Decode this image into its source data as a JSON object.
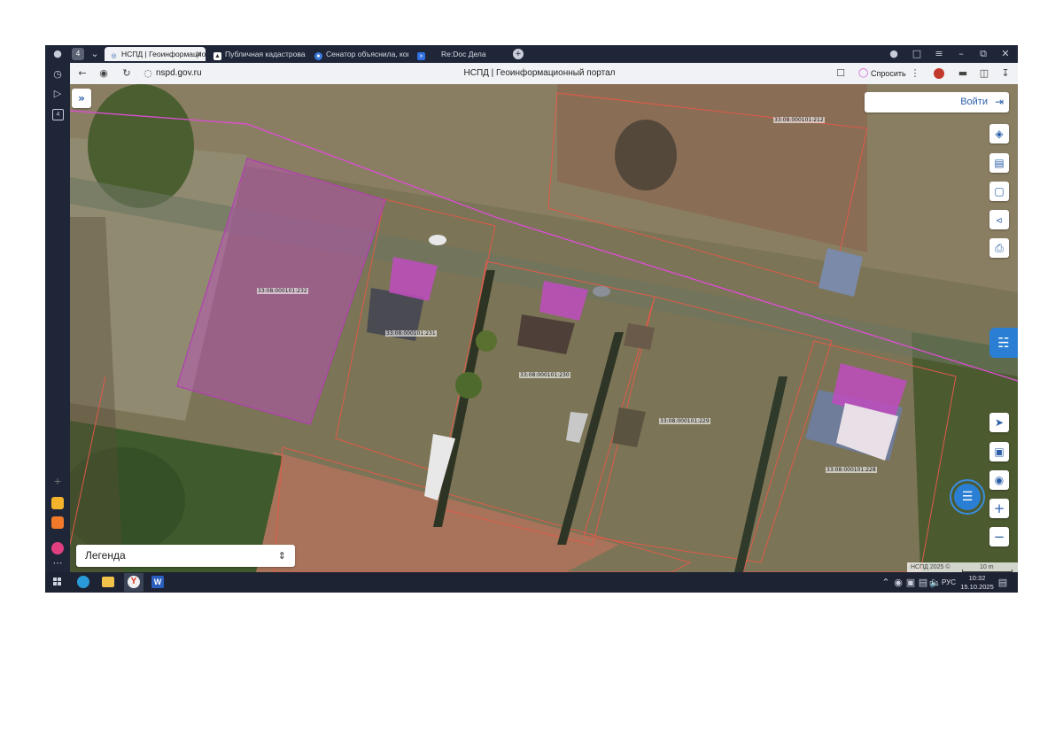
{
  "browser": {
    "tab_count": "4",
    "tabs": [
      {
        "label": "НСПД | Геоинформацио",
        "active": true
      },
      {
        "label": "Публичная кадастровая к"
      },
      {
        "label": "Сенатор объяснила, когд"
      },
      {
        "label": "Re:Doc Дела"
      }
    ],
    "url": "nspd.gov.ru",
    "page_title": "НСПД | Геоинформационный портал",
    "ask_label": "Спросить",
    "left_rail_badge": "4"
  },
  "map": {
    "login_label": "Войти",
    "legend_label": "Легенда",
    "attribution": "НСПД 2025 ©",
    "scale_label": "10 m",
    "parcels": [
      {
        "label": "33:08:000101:212"
      },
      {
        "label": "33:08:000101:232"
      },
      {
        "label": "33:08:000101:231"
      },
      {
        "label": "33:08:000101:230"
      },
      {
        "label": "33:08:000101:229"
      },
      {
        "label": "33:08:000101:228"
      }
    ],
    "colors": {
      "parcel_highlight": "#c04cc0",
      "boundary": "#e05a4a",
      "road_line": "#d94fd0",
      "ui_accent": "#2a5fa8"
    }
  },
  "taskbar": {
    "language": "РУС",
    "time": "10:32",
    "date": "15.10.2025"
  }
}
